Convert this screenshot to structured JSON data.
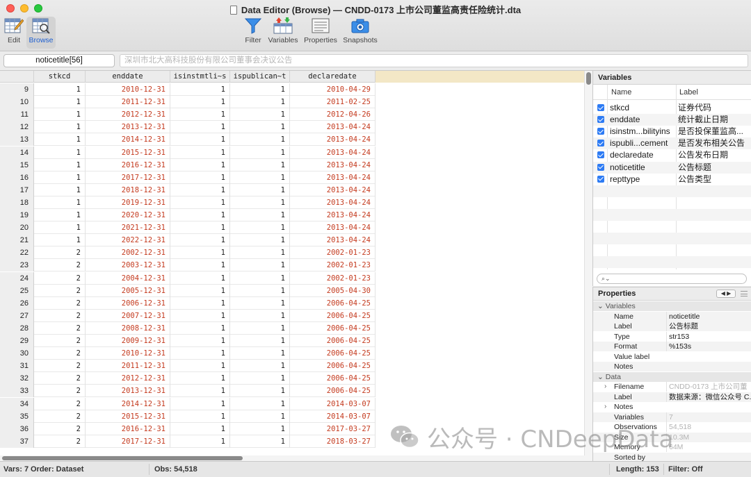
{
  "window": {
    "title": "Data Editor (Browse) — CNDD-0173 上市公司董监高责任险统计.dta"
  },
  "toolbar": {
    "edit_label": "Edit",
    "browse_label": "Browse",
    "filter_label": "Filter",
    "variables_label": "Variables",
    "properties_label": "Properties",
    "snapshots_label": "Snapshots"
  },
  "varbar": {
    "varname": "noticetitle[56]",
    "value": "深圳市北大高科技股份有限公司董事会决议公告"
  },
  "grid": {
    "columns": [
      "stkcd",
      "enddate",
      "isinstmtli~s",
      "ispublican~t",
      "declaredate"
    ],
    "rows": [
      {
        "n": "9",
        "stkcd": "1",
        "enddate": "2010-12-31",
        "isinst": "1",
        "ispub": "1",
        "declaredate": "2010-04-29"
      },
      {
        "n": "10",
        "stkcd": "1",
        "enddate": "2011-12-31",
        "isinst": "1",
        "ispub": "1",
        "declaredate": "2011-02-25"
      },
      {
        "n": "11",
        "stkcd": "1",
        "enddate": "2012-12-31",
        "isinst": "1",
        "ispub": "1",
        "declaredate": "2012-04-26"
      },
      {
        "n": "12",
        "stkcd": "1",
        "enddate": "2013-12-31",
        "isinst": "1",
        "ispub": "1",
        "declaredate": "2013-04-24"
      },
      {
        "n": "13",
        "stkcd": "1",
        "enddate": "2014-12-31",
        "isinst": "1",
        "ispub": "1",
        "declaredate": "2013-04-24"
      },
      {
        "n": "14",
        "stkcd": "1",
        "enddate": "2015-12-31",
        "isinst": "1",
        "ispub": "1",
        "declaredate": "2013-04-24"
      },
      {
        "n": "15",
        "stkcd": "1",
        "enddate": "2016-12-31",
        "isinst": "1",
        "ispub": "1",
        "declaredate": "2013-04-24"
      },
      {
        "n": "16",
        "stkcd": "1",
        "enddate": "2017-12-31",
        "isinst": "1",
        "ispub": "1",
        "declaredate": "2013-04-24"
      },
      {
        "n": "17",
        "stkcd": "1",
        "enddate": "2018-12-31",
        "isinst": "1",
        "ispub": "1",
        "declaredate": "2013-04-24"
      },
      {
        "n": "18",
        "stkcd": "1",
        "enddate": "2019-12-31",
        "isinst": "1",
        "ispub": "1",
        "declaredate": "2013-04-24"
      },
      {
        "n": "19",
        "stkcd": "1",
        "enddate": "2020-12-31",
        "isinst": "1",
        "ispub": "1",
        "declaredate": "2013-04-24"
      },
      {
        "n": "20",
        "stkcd": "1",
        "enddate": "2021-12-31",
        "isinst": "1",
        "ispub": "1",
        "declaredate": "2013-04-24"
      },
      {
        "n": "21",
        "stkcd": "1",
        "enddate": "2022-12-31",
        "isinst": "1",
        "ispub": "1",
        "declaredate": "2013-04-24"
      },
      {
        "n": "22",
        "stkcd": "2",
        "enddate": "2002-12-31",
        "isinst": "1",
        "ispub": "1",
        "declaredate": "2002-01-23"
      },
      {
        "n": "23",
        "stkcd": "2",
        "enddate": "2003-12-31",
        "isinst": "1",
        "ispub": "1",
        "declaredate": "2002-01-23"
      },
      {
        "n": "24",
        "stkcd": "2",
        "enddate": "2004-12-31",
        "isinst": "1",
        "ispub": "1",
        "declaredate": "2002-01-23"
      },
      {
        "n": "25",
        "stkcd": "2",
        "enddate": "2005-12-31",
        "isinst": "1",
        "ispub": "1",
        "declaredate": "2005-04-30"
      },
      {
        "n": "26",
        "stkcd": "2",
        "enddate": "2006-12-31",
        "isinst": "1",
        "ispub": "1",
        "declaredate": "2006-04-25"
      },
      {
        "n": "27",
        "stkcd": "2",
        "enddate": "2007-12-31",
        "isinst": "1",
        "ispub": "1",
        "declaredate": "2006-04-25"
      },
      {
        "n": "28",
        "stkcd": "2",
        "enddate": "2008-12-31",
        "isinst": "1",
        "ispub": "1",
        "declaredate": "2006-04-25"
      },
      {
        "n": "29",
        "stkcd": "2",
        "enddate": "2009-12-31",
        "isinst": "1",
        "ispub": "1",
        "declaredate": "2006-04-25"
      },
      {
        "n": "30",
        "stkcd": "2",
        "enddate": "2010-12-31",
        "isinst": "1",
        "ispub": "1",
        "declaredate": "2006-04-25"
      },
      {
        "n": "31",
        "stkcd": "2",
        "enddate": "2011-12-31",
        "isinst": "1",
        "ispub": "1",
        "declaredate": "2006-04-25"
      },
      {
        "n": "32",
        "stkcd": "2",
        "enddate": "2012-12-31",
        "isinst": "1",
        "ispub": "1",
        "declaredate": "2006-04-25"
      },
      {
        "n": "33",
        "stkcd": "2",
        "enddate": "2013-12-31",
        "isinst": "1",
        "ispub": "1",
        "declaredate": "2006-04-25"
      },
      {
        "n": "34",
        "stkcd": "2",
        "enddate": "2014-12-31",
        "isinst": "1",
        "ispub": "1",
        "declaredate": "2014-03-07"
      },
      {
        "n": "35",
        "stkcd": "2",
        "enddate": "2015-12-31",
        "isinst": "1",
        "ispub": "1",
        "declaredate": "2014-03-07"
      },
      {
        "n": "36",
        "stkcd": "2",
        "enddate": "2016-12-31",
        "isinst": "1",
        "ispub": "1",
        "declaredate": "2017-03-27"
      },
      {
        "n": "37",
        "stkcd": "2",
        "enddate": "2017-12-31",
        "isinst": "1",
        "ispub": "1",
        "declaredate": "2018-03-27"
      }
    ]
  },
  "variables_panel": {
    "title": "Variables",
    "col_name": "Name",
    "col_label": "Label",
    "items": [
      {
        "name": "stkcd",
        "label": "证券代码"
      },
      {
        "name": "enddate",
        "label": "统计截止日期"
      },
      {
        "name": "isinstm...bilityins",
        "label": "是否投保董监高..."
      },
      {
        "name": "ispubli...cement",
        "label": "是否发布相关公告"
      },
      {
        "name": "declaredate",
        "label": "公告发布日期"
      },
      {
        "name": "noticetitle",
        "label": "公告标题"
      },
      {
        "name": "repttype",
        "label": "公告类型"
      }
    ]
  },
  "properties_panel": {
    "title": "Properties",
    "sec_variables": "Variables",
    "sec_data": "Data",
    "var_props": [
      {
        "k": "Name",
        "v": "noticetitle"
      },
      {
        "k": "Label",
        "v": "公告标题"
      },
      {
        "k": "Type",
        "v": "str153"
      },
      {
        "k": "Format",
        "v": "%153s"
      },
      {
        "k": "Value label",
        "v": ""
      },
      {
        "k": "Notes",
        "v": ""
      }
    ],
    "data_props": [
      {
        "k": "Filename",
        "v": "CNDD-0173 上市公司董"
      },
      {
        "k": "Label",
        "v": "数据来源：微信公众号 C..."
      },
      {
        "k": "Notes",
        "v": ""
      },
      {
        "k": "Variables",
        "v": "7"
      },
      {
        "k": "Observations",
        "v": "54,518"
      },
      {
        "k": "Size",
        "v": "10.3M"
      },
      {
        "k": "Memory",
        "v": "64M"
      },
      {
        "k": "Sorted by",
        "v": ""
      }
    ]
  },
  "status": {
    "vars": "Vars: 7",
    "order": "Order: Dataset",
    "obs": "Obs: 54,518",
    "length": "Length: 153",
    "filter": "Filter: Off"
  },
  "watermark": {
    "text": "公众号 · CNDeepData"
  },
  "colors": {
    "date_red": "#c43a1e",
    "checkbox_blue": "#2d7bf4",
    "accent": "#1d5fd1"
  }
}
